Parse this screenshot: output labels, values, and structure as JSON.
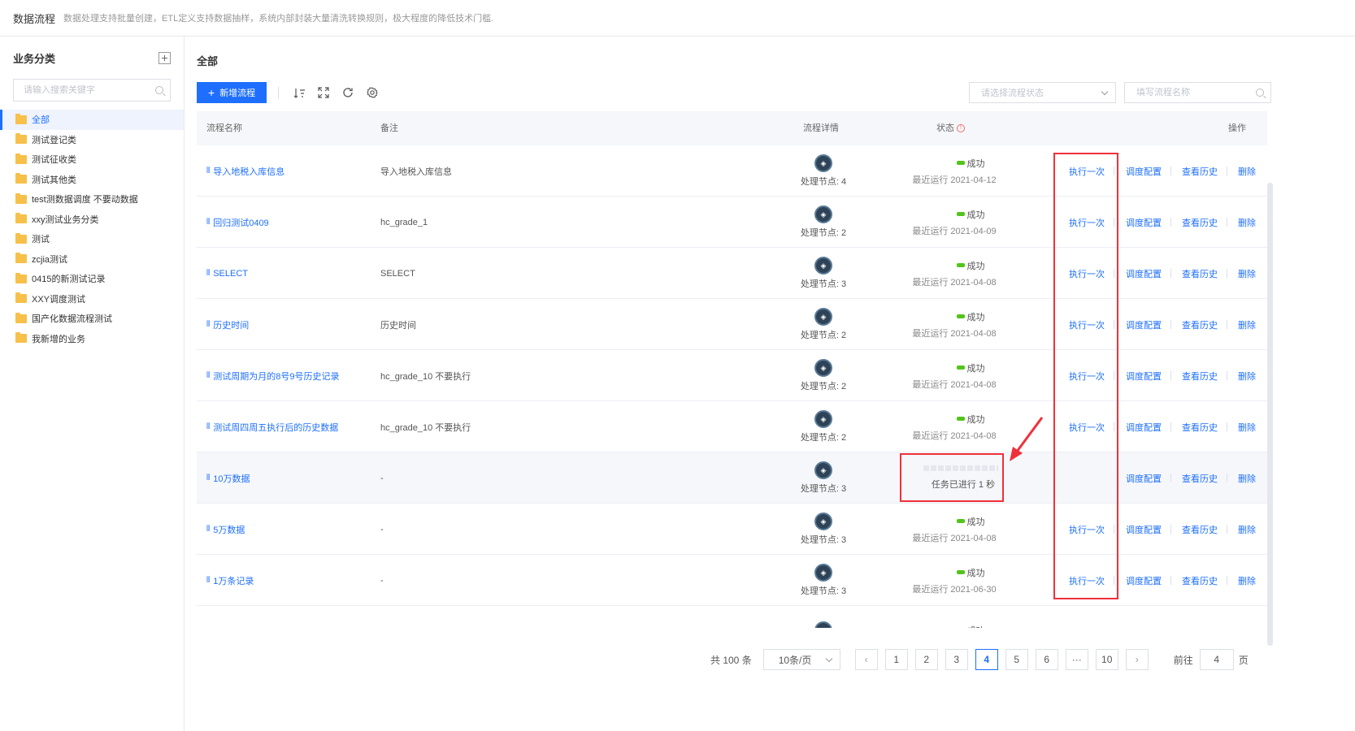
{
  "header": {
    "title": "数据流程",
    "desc": "数据处理支持批量创建，ETL定义支持数据抽样，系统内部封装大量清洗转换规则，极大程度的降低技术门槛."
  },
  "sidebar": {
    "title": "业务分类",
    "search_placeholder": "请输入搜索关键字",
    "items": [
      {
        "label": "全部"
      },
      {
        "label": "测试登记类"
      },
      {
        "label": "测试征收类"
      },
      {
        "label": "测试其他类"
      },
      {
        "label": "test测数据调度 不要动数据"
      },
      {
        "label": "xxy测试业务分类"
      },
      {
        "label": "测试"
      },
      {
        "label": "zcjia测试"
      },
      {
        "label": "0415的新测试记录"
      },
      {
        "label": "XXY调度测试"
      },
      {
        "label": "国产化数据流程测试"
      },
      {
        "label": "我新增的业务"
      }
    ]
  },
  "main": {
    "title": "全部",
    "add_button": "新增流程",
    "status_placeholder": "请选择流程状态",
    "name_placeholder": "填写流程名称"
  },
  "table": {
    "columns": {
      "name": "流程名称",
      "note": "备注",
      "detail": "流程详情",
      "status": "状态",
      "ops": "操作"
    },
    "ops_labels": {
      "run": "执行一次",
      "schedule": "调度配置",
      "history": "查看历史",
      "delete": "删除"
    },
    "rows": [
      {
        "name": "导入地税入库信息",
        "note": "导入地税入库信息",
        "nodes": "处理节点: 4",
        "status": "成功",
        "last": "最近运行 2021-04-12"
      },
      {
        "name": "回归测试0409",
        "note": "hc_grade_1",
        "nodes": "处理节点: 2",
        "status": "成功",
        "last": "最近运行 2021-04-09"
      },
      {
        "name": "SELECT",
        "note": "SELECT",
        "nodes": "处理节点: 3",
        "status": "成功",
        "last": "最近运行 2021-04-08"
      },
      {
        "name": "历史时间",
        "note": "历史时间",
        "nodes": "处理节点: 2",
        "status": "成功",
        "last": "最近运行 2021-04-08"
      },
      {
        "name": "测试周期为月的8号9号历史记录",
        "note": "hc_grade_10 不要执行",
        "nodes": "处理节点: 2",
        "status": "成功",
        "last": "最近运行 2021-04-08"
      },
      {
        "name": "测试周四周五执行后的历史数据",
        "note": "hc_grade_10 不要执行",
        "nodes": "处理节点: 2",
        "status": "成功",
        "last": "最近运行 2021-04-08"
      },
      {
        "name": "10万数据",
        "note": "-",
        "nodes": "处理节点: 3",
        "running": "任务已进行 1 秒"
      },
      {
        "name": "5万数据",
        "note": "-",
        "nodes": "处理节点: 3",
        "status": "成功",
        "last": "最近运行 2021-04-08"
      },
      {
        "name": "1万条记录",
        "note": "-",
        "nodes": "处理节点: 3",
        "status": "成功",
        "last": "最近运行 2021-06-30"
      },
      {
        "name": "",
        "note": "",
        "nodes": "",
        "status": "成功",
        "last": ""
      }
    ]
  },
  "pagination": {
    "total": "共 100 条",
    "page_size": "10条/页",
    "pages": [
      "1",
      "2",
      "3",
      "4",
      "5",
      "6",
      "···",
      "10"
    ],
    "current": "4",
    "goto_label": "前往",
    "goto_value": "4",
    "page_suffix": "页"
  },
  "colors": {
    "primary": "#1e6fff",
    "success": "#52c41a",
    "highlight": "#f0303a"
  }
}
